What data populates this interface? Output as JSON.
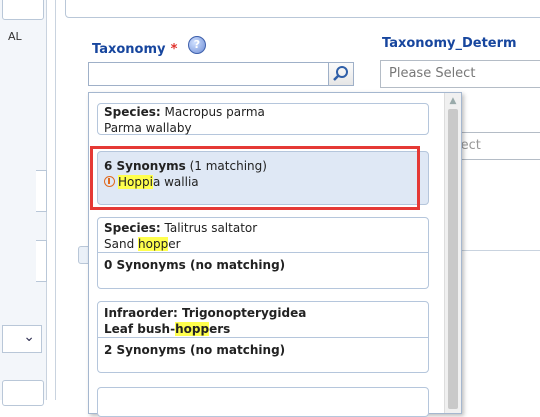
{
  "left_panel": {
    "label_fragment": "AL"
  },
  "taxonomy": {
    "label": "Taxonomy",
    "required_mark": "*",
    "help_glyph": "?",
    "search_value": ""
  },
  "taxonomy_determ": {
    "label": "Taxonomy_Determ",
    "placeholder": "Please Select",
    "partial_label": "e",
    "partial_placeholder": "elect"
  },
  "results": [
    {
      "kind": "Species:",
      "name": "Macropus parma",
      "common": "Parma wallaby"
    },
    {
      "synonyms": "6 Synonyms",
      "matching": " (1 matching)",
      "syn_hl": "Hoppi",
      "syn_rest": "a wallia"
    },
    {
      "kind": "Species:",
      "name": "Talitrus saltator",
      "common_pre": "Sand ",
      "common_hl": "hopp",
      "common_post": "er",
      "synonyms": "0 Synonyms (no matching)"
    },
    {
      "kind": "Infraorder:",
      "name": "Trigonopterygidea",
      "common_pre": "Leaf bush-",
      "common_hl": "hopp",
      "common_post": "ers",
      "synonyms": "2 Synonyms (no matching)"
    }
  ],
  "colors": {
    "label": "#17469e",
    "required": "#e53935",
    "highlight": "#ffff4d",
    "selected_bg": "#dfe8f5"
  }
}
